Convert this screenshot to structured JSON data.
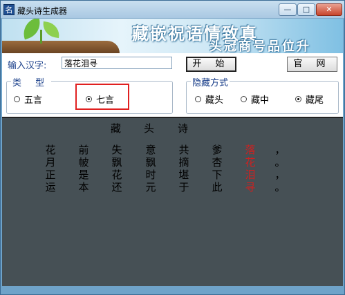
{
  "window": {
    "title": "藏头诗生成器",
    "app_icon_glyph": "名"
  },
  "title_buttons": {
    "minimize": "—",
    "maximize": "□",
    "close": "✕"
  },
  "banner": {
    "title": "藏嵌祝语情致真",
    "subtitle": "头冠商号品位升"
  },
  "form": {
    "input_label": "输入汉字:",
    "input_value": "落花泪寻",
    "start_button": "开 始",
    "site_button": "官 网"
  },
  "type_group": {
    "legend": "类 型",
    "options": [
      {
        "label": "五言",
        "selected": false
      },
      {
        "label": "七言",
        "selected": true
      }
    ]
  },
  "hide_group": {
    "legend": "隐藏方式",
    "options": [
      {
        "label": "藏头",
        "selected": false
      },
      {
        "label": "藏中",
        "selected": false
      },
      {
        "label": "藏尾",
        "selected": true
      }
    ]
  },
  "poem": {
    "title": [
      "藏",
      "头",
      "诗"
    ],
    "columns": [
      [
        "花",
        "月",
        "正",
        "运"
      ],
      [
        "前",
        "帔",
        "是",
        "本"
      ],
      [
        "失",
        "飘",
        "花",
        "还"
      ],
      [
        "意",
        "飘",
        "时",
        "元"
      ],
      [
        "共",
        "摘",
        "堪",
        "于"
      ],
      [
        "爹",
        "杏",
        "下",
        "此"
      ],
      [
        "落",
        "花",
        "泪",
        "寻"
      ]
    ],
    "highlight_column": 6,
    "punctuation": [
      "，",
      "。",
      "，",
      "。"
    ],
    "highlight_color": "#d02020"
  },
  "colors": {
    "frame": "#6fa3c9",
    "panel": "#465055",
    "label_blue": "#1a3f8a"
  }
}
